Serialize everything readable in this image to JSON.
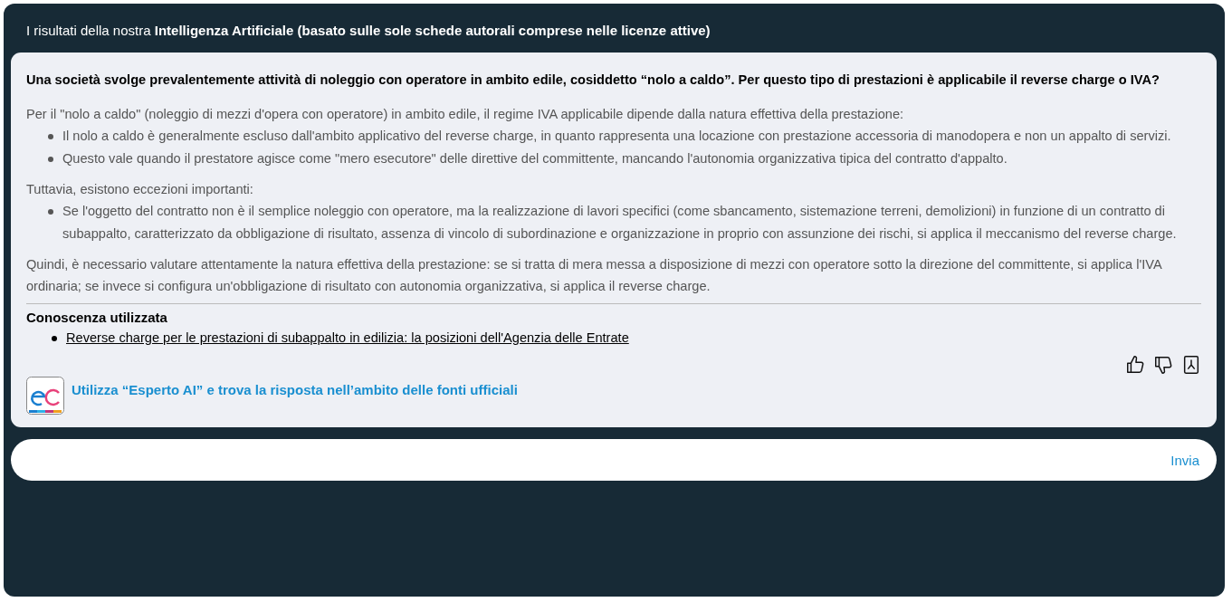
{
  "header": {
    "title": "I risultati della nostra **Intelligenza Artificiale (basato sulle sole schede autorali comprese nelle licenze attive)**"
  },
  "question": "Una società svolge prevalentemente attività di noleggio con operatore in ambito edile, cosiddetto “nolo a caldo”. Per questo tipo di prestazioni è applicabile il reverse charge o IVA?",
  "answer": [
    {
      "kind": "paragraph",
      "text": "Per il \"nolo a caldo\" (noleggio di mezzi d'opera con operatore) in ambito edile, il regime IVA applicabile dipende dalla natura effettiva della prestazione:"
    },
    {
      "kind": "list",
      "items": [
        "Il nolo a caldo è generalmente escluso dall'ambito applicativo del reverse charge, in quanto rappresenta una locazione con prestazione accessoria di manodopera e non un appalto di servizi.",
        "Questo vale quando il prestatore agisce come \"mero esecutore\" delle direttive del committente, mancando l'autonomia organizzativa tipica del contratto d'appalto."
      ]
    },
    {
      "kind": "paragraph",
      "text": "Tuttavia, esistono eccezioni importanti:"
    },
    {
      "kind": "list",
      "items": [
        "Se l'oggetto del contratto non è il semplice noleggio con operatore, ma la realizzazione di lavori specifici (come sbancamento, sistemazione terreni, demolizioni) in funzione di un contratto di subappalto, caratterizzato da obbligazione di risultato, assenza di vincolo di subordinazione e organizzazione in proprio con assunzione dei rischi, si applica il meccanismo del reverse charge."
      ]
    },
    {
      "kind": "paragraph",
      "text": "Quindi, è necessario valutare attentamente la natura effettiva della prestazione: se si tratta di mera messa a disposizione di mezzi con operatore sotto la direzione del committente, si applica l'IVA ordinaria; se invece si configura un'obbligazione di risultato con autonomia organizzativa, si applica il reverse charge."
    }
  ],
  "knowledge": {
    "title": "Conoscenza utilizzata",
    "links": [
      "Reverse charge per le prestazioni di subappalto in edilizia: la posizioni dell'Agenzia delle Entrate"
    ]
  },
  "expert_link": "Utilizza “Esperto AI” e trova la risposta nell’ambito delle fonti ufficiali",
  "send_button": "Invia"
}
